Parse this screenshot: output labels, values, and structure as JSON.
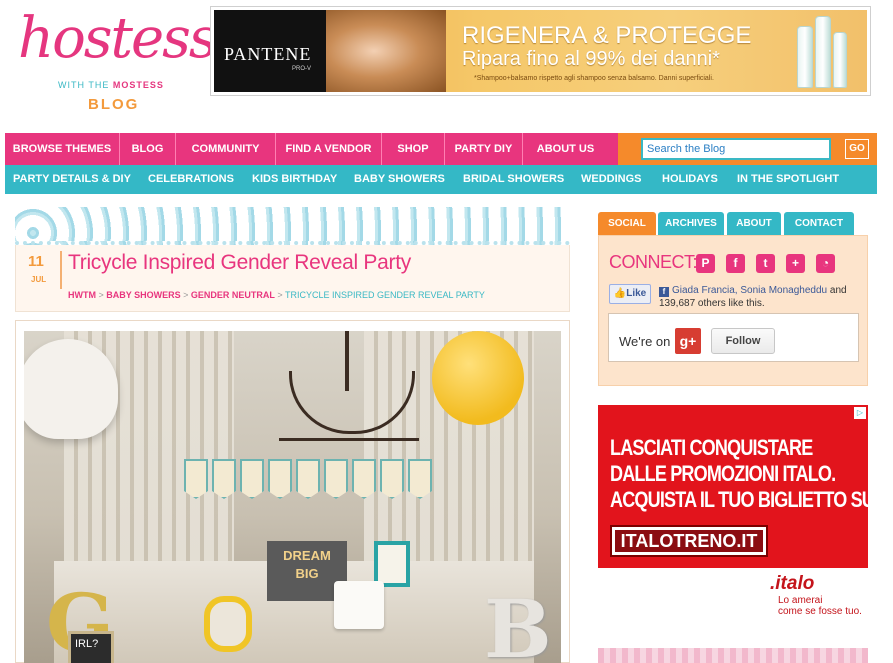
{
  "logo": {
    "main": "hostess",
    "tag_pre": "WITH THE",
    "tag_brand": "MOSTESS",
    "blog": "BLOG"
  },
  "top_ad": {
    "brand": "PANTENE",
    "brand_sub": "PRO-V",
    "headline": "RIGENERA & PROTEGGE",
    "subline": "Ripara fino al 99% dei danni*",
    "fine": "*Shampoo+balsamo rispetto agli shampoo senza balsamo. Danni superficiali."
  },
  "nav_primary": [
    "BROWSE THEMES",
    "BLOG",
    "COMMUNITY",
    "FIND A VENDOR",
    "SHOP",
    "PARTY DIY",
    "ABOUT US"
  ],
  "search": {
    "placeholder": "Search the Blog",
    "button": "GO"
  },
  "nav_secondary": [
    "PARTY DETAILS & DIY",
    "CELEBRATIONS",
    "KIDS BIRTHDAY",
    "BABY SHOWERS",
    "BRIDAL SHOWERS",
    "WEDDINGS",
    "HOLIDAYS",
    "IN THE SPOTLIGHT"
  ],
  "post": {
    "day": "11",
    "month": "JUL",
    "title": "Tricycle Inspired Gender Reveal Party",
    "crumbs": [
      "HWTM",
      "BABY SHOWERS",
      "GENDER NEUTRAL"
    ],
    "crumb_current": "TRICYCLE INSPIRED GENDER REVEAL PARTY",
    "crumb_sep": " > ",
    "photo_text": {
      "dream": "DREAM",
      "big": "BIG",
      "letter_g": "G",
      "letter_b": "B",
      "chalk_girl": "IRL?"
    }
  },
  "sidebar": {
    "tabs": [
      "SOCIAL",
      "ARCHIVES",
      "ABOUT",
      "CONTACT"
    ],
    "connect": "CONNECT:",
    "social_icons": [
      {
        "icon": "pinterest-icon",
        "glyph": "P"
      },
      {
        "icon": "facebook-icon",
        "glyph": "f"
      },
      {
        "icon": "twitter-icon",
        "glyph": "t"
      },
      {
        "icon": "googleplus-icon",
        "glyph": "+"
      },
      {
        "icon": "rss-icon",
        "glyph": "◔"
      }
    ],
    "like_button": "Like",
    "fb_names": "Giada Francia, Sonia Monagheddu",
    "fb_and": " and ",
    "fb_count": "139,687 others like this.",
    "weron": "We're on",
    "gplus": "g+",
    "follow": "Follow"
  },
  "side_ad": {
    "lines": [
      "LASCIATI CONQUISTARE",
      "DALLE PROMOZIONI ITALO.",
      "ACQUISTA IL TUO BIGLIETTO SU:"
    ],
    "button": "ITALOTRENO.IT",
    "brand": ".italo",
    "tagline": [
      "Lo amerai",
      "come se fosse tuo."
    ],
    "adchoice": "▷"
  },
  "colors": {
    "pink": "#e8357e",
    "orange": "#f58a2b",
    "teal": "#34b8c6",
    "peach": "#fde4cc",
    "italo_red": "#e2141c"
  }
}
